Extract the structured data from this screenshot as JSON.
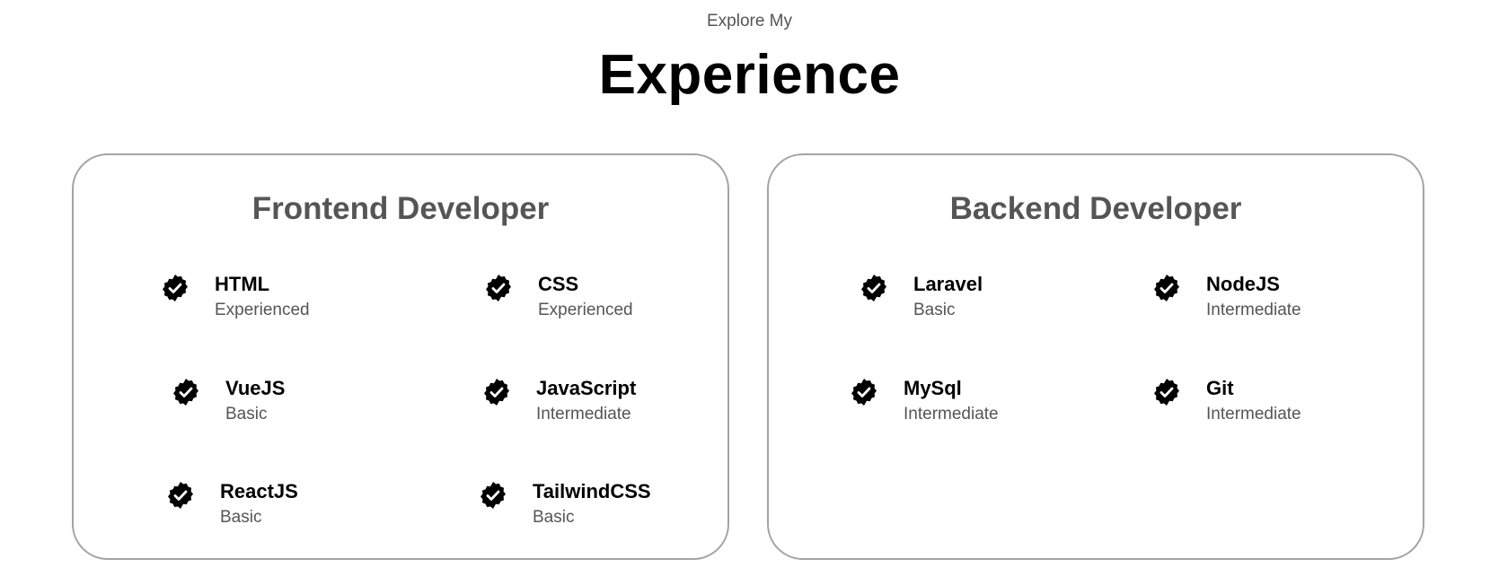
{
  "header": {
    "subtitle": "Explore My",
    "title": "Experience"
  },
  "cards": [
    {
      "title": "Frontend Developer",
      "items": [
        {
          "name": "HTML",
          "level": "Experienced"
        },
        {
          "name": "CSS",
          "level": "Experienced"
        },
        {
          "name": "VueJS",
          "level": "Basic"
        },
        {
          "name": "JavaScript",
          "level": "Intermediate"
        },
        {
          "name": "ReactJS",
          "level": "Basic"
        },
        {
          "name": "TailwindCSS",
          "level": "Basic"
        }
      ]
    },
    {
      "title": "Backend Developer",
      "items": [
        {
          "name": "Laravel",
          "level": "Basic"
        },
        {
          "name": "NodeJS",
          "level": "Intermediate"
        },
        {
          "name": "MySql",
          "level": "Intermediate"
        },
        {
          "name": "Git",
          "level": "Intermediate"
        }
      ]
    }
  ]
}
